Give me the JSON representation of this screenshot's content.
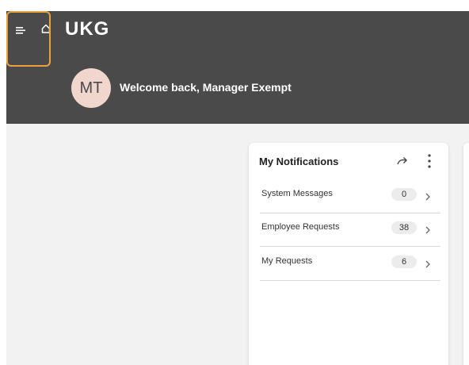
{
  "header": {
    "logo_text": "UKG",
    "avatar_initials": "MT",
    "welcome_text": "Welcome back, Manager Exempt",
    "background_color": "#4a4a4a",
    "focus_ring_color": "#e8a33d",
    "icons": [
      "menu-icon",
      "home-icon"
    ]
  },
  "notifications": {
    "title": "My Notifications",
    "icons": [
      "share-arrow-icon",
      "more-vertical-icon",
      "chevron-right-icon"
    ],
    "items": [
      {
        "label": "System Messages",
        "count": "0"
      },
      {
        "label": "Employee Requests",
        "count": "38"
      },
      {
        "label": "My Requests",
        "count": "6"
      }
    ]
  }
}
